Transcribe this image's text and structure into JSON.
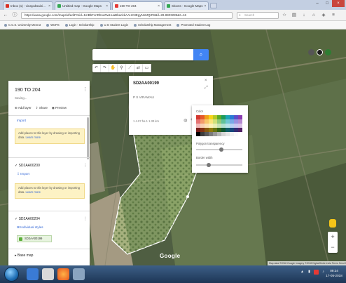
{
  "browser": {
    "tabs": [
      {
        "label": "Inbox (1) - vinayaksaini...",
        "favicon_color": "#d93025"
      },
      {
        "label": "Untitled map - Google Maps",
        "favicon_color": "#34a853"
      },
      {
        "label": "190 TO 204",
        "favicon_color": "#e53935"
      },
      {
        "label": "Sbocts - Google Maps",
        "favicon_color": "#34a853"
      }
    ],
    "url": "https://www.google.com/maps/d/edit?mid=1mBbFcnRbnuRwHuaBbackkAAHJNEgyNnMQrR8&ll=28.8803289&z=16",
    "search_placeholder": "Search",
    "bookmarks": [
      "C.C.S. University Meerut",
      "WCPS",
      "Login - Scholarship",
      "U.G Student Login",
      "Scholarship Management",
      "Promoted Student Log"
    ]
  },
  "map": {
    "search_button_icon": "search-icon",
    "google_logo": "Google",
    "attribution": "Map data ©2018 Google Imagery ©2018 DigitalGlobe  India  Terms  Send feedback  200 m"
  },
  "panel": {
    "title": "190 TO 204",
    "subtitle": "Saving...",
    "actions": {
      "add_layer": "Add layer",
      "share": "Share",
      "preview": "Preview"
    },
    "layers": [
      {
        "link": "Import",
        "note_text": "Add places to this layer by drawing or importing data.",
        "note_link": "Learn more"
      },
      {
        "name": "SD2AA00200",
        "link": "Import",
        "note_text": "Add places to this layer by drawing or importing data.",
        "note_link": "Learn more"
      },
      {
        "name": "SD2AA00204",
        "link": "Individual styles",
        "item": "SD2AA00199"
      }
    ],
    "base_map": "Base map"
  },
  "info_card": {
    "title": "SD2AA00199",
    "line": "P S  VIRAWALI",
    "meta": "1 4.07 ha   1 1.33 km"
  },
  "color_picker": {
    "label": "Color",
    "transparency_label": "Polygon transparency",
    "width_label": "Border width",
    "transparency_value": 0.55,
    "width_value": 0.25,
    "swatches": [
      "#d33a32",
      "#e55a2b",
      "#f0a11a",
      "#f6d319",
      "#b5c926",
      "#5cab2b",
      "#1e9b5b",
      "#1da4b6",
      "#2a7ad3",
      "#5a4fc9",
      "#8a3bb0",
      "#e57373",
      "#f39b6b",
      "#f7c76b",
      "#f9e47c",
      "#cfe07a",
      "#91c97a",
      "#5fc29a",
      "#6fc7d3",
      "#78a9e6",
      "#9a91df",
      "#b58ad1",
      "#f2b8b8",
      "#f8cfb3",
      "#fbe2b3",
      "#fcf1b8",
      "#e8efb5",
      "#c6e2b7",
      "#b0e0cf",
      "#b6e3ea",
      "#b9d1f2",
      "#cbc6f0",
      "#d9c2e8",
      "#7a1f1b",
      "#843315",
      "#8a5c10",
      "#8f7a0f",
      "#687515",
      "#346418",
      "#125a34",
      "#125f6a",
      "#17477b",
      "#342e75",
      "#512266",
      "#000000",
      "#3d3d3d",
      "#5c5c5c",
      "#7b7b7b",
      "#9a9a9a",
      "#b8b8b8",
      "#d6d6d6",
      "#e6e6e6",
      "#f2f2f2",
      "#fafafa",
      "#ffffff"
    ]
  },
  "taskbar": {
    "clock_time": "09:24",
    "clock_date": "17-05-2018"
  }
}
